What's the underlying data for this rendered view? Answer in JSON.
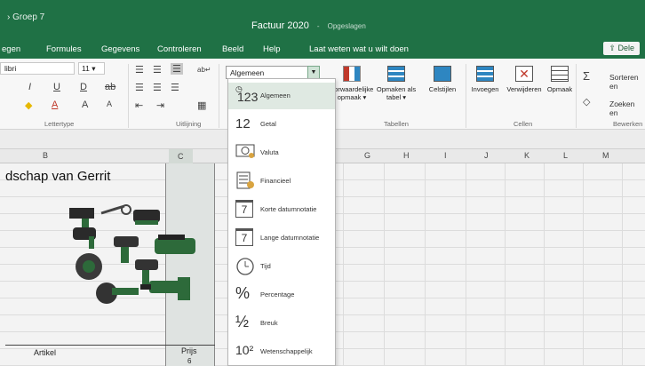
{
  "window": {
    "group": "› Groep 7",
    "title": "Factuur 2020",
    "separator": "-",
    "saved_status": "Opgeslagen"
  },
  "menu": {
    "tabs": [
      "egen",
      "Formules",
      "Gegevens",
      "Controleren",
      "Beeld",
      "Help"
    ],
    "tell_me": "Laat weten wat u wilt doen",
    "share": "Dele"
  },
  "ribbon": {
    "font_name": "libri",
    "font_size": "11",
    "group_lettertype": "Lettertype",
    "group_uitlijning": "Uitlijning",
    "number_format_value": "Algemeen",
    "group_tabellen": "Tabellen",
    "group_cellen": "Cellen",
    "group_bewerken": "Bewerken",
    "btn_voorwaardelijk": "oorwaardelijke opmaak ▾",
    "btn_opmaken_tabel": "Opmaken als tabel ▾",
    "btn_celstijlen": "Celstijlen",
    "btn_invoegen": "Invoegen",
    "btn_verwijderen": "Verwijderen",
    "btn_opmaak": "Opmaak",
    "btn_sorteren": "Sorteren en",
    "btn_zoeken": "Zoeken en",
    "italic": "I",
    "underline": "U",
    "double_underline": "D",
    "strike": "ab",
    "grow_font": "A",
    "shrink_font": "A",
    "font_color": "A",
    "sigma": "Σ"
  },
  "columns": [
    "B",
    "C",
    "G",
    "H",
    "I",
    "J",
    "K",
    "L",
    "M"
  ],
  "sheet": {
    "title_cell": "dschap van Gerrit",
    "header_artikel": "Artikel",
    "header_prijs": "Prijs",
    "value_prijs_1": "6"
  },
  "number_formats": [
    {
      "icon_text": "123",
      "label": "Algemeen"
    },
    {
      "icon_text": "12",
      "label": "Getal"
    },
    {
      "icon_text": "",
      "label": "Valuta"
    },
    {
      "icon_text": "",
      "label": "Financieel"
    },
    {
      "icon_text": "7",
      "label": "Korte datumnotatie"
    },
    {
      "icon_text": "7",
      "label": "Lange datumnotatie"
    },
    {
      "icon_text": "",
      "label": "Tijd"
    },
    {
      "icon_text": "%",
      "label": "Percentage"
    },
    {
      "icon_text": "½",
      "label": "Breuk"
    },
    {
      "icon_text": "10²",
      "label": "Wetenschappelijk"
    }
  ],
  "colors": {
    "excel_green": "#1f7145",
    "highlight": "#dfe9e2"
  }
}
